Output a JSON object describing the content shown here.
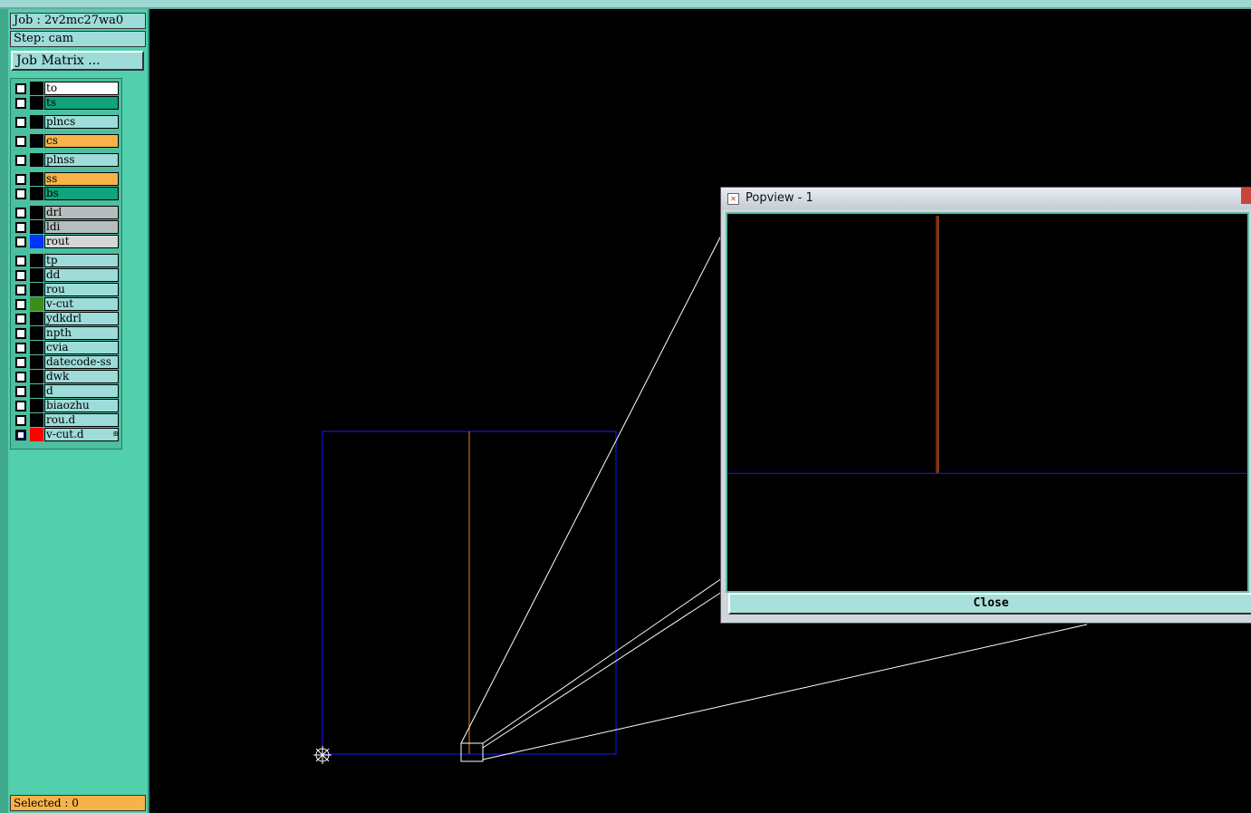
{
  "job_label": "Job : 2v2mc27wa0",
  "step_label": "Step: cam",
  "job_matrix_button": "Job Matrix ...",
  "layers": [
    {
      "name": "to",
      "color": "#ffffff"
    },
    {
      "name": "ts",
      "color": "#11a37b"
    },
    {
      "name": "plncs",
      "color": "#9ddcd9"
    },
    {
      "name": "cs",
      "color": "#f7b24a"
    },
    {
      "name": "plnss",
      "color": "#9ddcd9"
    },
    {
      "name": "ss",
      "color": "#f7b24a"
    },
    {
      "name": "bs",
      "color": "#11a37b"
    },
    {
      "name": "drl",
      "color": "#b6bdbd"
    },
    {
      "name": "ldi",
      "color": "#b6bdbd"
    },
    {
      "name": "rout",
      "color": "#d6d6d6",
      "swatch": "#0033ff"
    },
    {
      "name": "tp",
      "color": "#9ddcd9"
    },
    {
      "name": "dd",
      "color": "#9ddcd9"
    },
    {
      "name": "rou",
      "color": "#9ddcd9"
    },
    {
      "name": "v-cut",
      "color": "#9ddcd9",
      "swatch": "#3a8f1a"
    },
    {
      "name": "ydkdrl",
      "color": "#9ddcd9"
    },
    {
      "name": "npth",
      "color": "#9ddcd9"
    },
    {
      "name": "cvia",
      "color": "#9ddcd9"
    },
    {
      "name": "datecode-ss",
      "color": "#9ddcd9"
    },
    {
      "name": "dwk",
      "color": "#9ddcd9"
    },
    {
      "name": "d",
      "color": "#9ddcd9"
    },
    {
      "name": "biaozhu",
      "color": "#9ddcd9"
    },
    {
      "name": "rou.d",
      "color": "#9ddcd9"
    },
    {
      "name": "v-cut.d",
      "color": "#9ddcd9",
      "swatch": "#ff0000",
      "active": true,
      "marker": "⊞"
    }
  ],
  "selected_label": "Selected : 0",
  "popview": {
    "title": "Popview - 1",
    "close_button": "Close"
  }
}
